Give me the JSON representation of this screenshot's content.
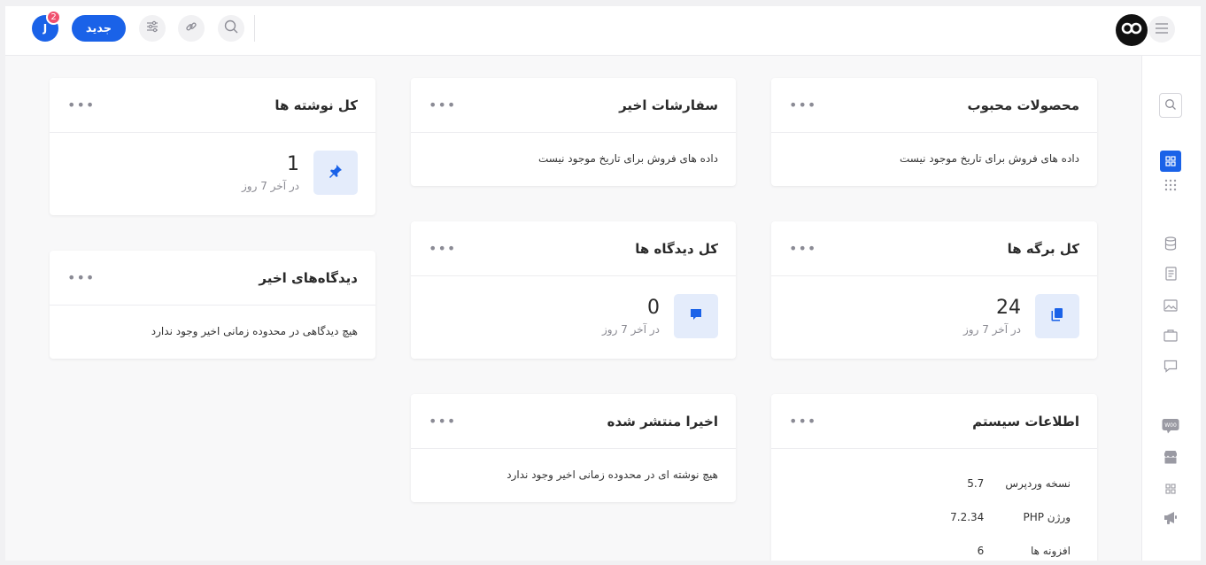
{
  "header": {
    "avatar_letter": "J",
    "notification_count": "2",
    "new_label": "جدید"
  },
  "cards": {
    "popular_products": {
      "title": "محصولات محبوب",
      "empty_text": "داده های فروش برای تاریخ موجود نیست"
    },
    "recent_orders": {
      "title": "سفارشات اخیر",
      "empty_text": "داده های فروش برای تاریخ موجود نیست"
    },
    "total_posts": {
      "title": "کل نوشته ها",
      "value": "1",
      "subtitle": "در آخر 7 روز"
    },
    "total_pages": {
      "title": "کل برگه ها",
      "value": "24",
      "subtitle": "در آخر 7 روز"
    },
    "total_comments": {
      "title": "کل دیدگاه ها",
      "value": "0",
      "subtitle": "در آخر 7 روز"
    },
    "recent_comments": {
      "title": "دیدگاه‌های اخیر",
      "empty_text": "هیچ دیدگاهی در محدوده زمانی اخیر وجود ندارد"
    },
    "recently_published": {
      "title": "اخیرا منتشر شده",
      "empty_text": "هیچ نوشته ای در محدوده زمانی اخیر وجود ندارد"
    },
    "system_info": {
      "title": "اطلاعات سیستم",
      "rows": [
        {
          "label": "نسخه وردپرس",
          "value": "5.7"
        },
        {
          "label": "ورژن PHP",
          "value": "7.2.34"
        },
        {
          "label": "افزونه ها",
          "value": "6"
        }
      ]
    }
  },
  "menu_dots": "•••",
  "colors": {
    "accent": "#1a62e8",
    "badge": "#f0506e",
    "icon_bg": "#e4ecfb"
  }
}
